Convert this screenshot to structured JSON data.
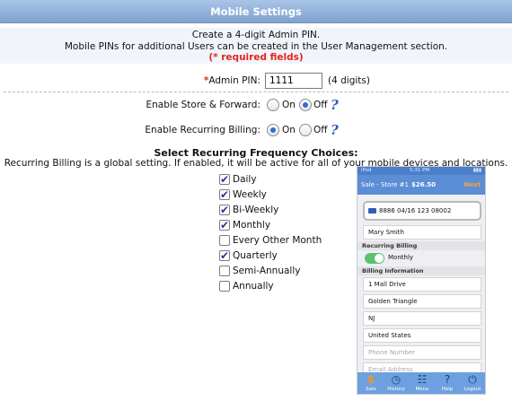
{
  "header": {
    "title": "Mobile Settings"
  },
  "intro": {
    "line1": "Create a 4-digit Admin PIN.",
    "line2": "Mobile PINs for additional Users can be created in the User Management section.",
    "required_note": "(* required fields)"
  },
  "admin_pin": {
    "star": "*",
    "label": "Admin PIN:",
    "value": "1111",
    "hint": "(4 digits)"
  },
  "store_forward": {
    "label": "Enable Store & Forward:",
    "on_label": "On",
    "off_label": "Off",
    "selected": "Off"
  },
  "recurring_billing": {
    "label": "Enable Recurring Billing:",
    "on_label": "On",
    "off_label": "Off",
    "selected": "On"
  },
  "frequency": {
    "title": "Select Recurring Frequency Choices:",
    "note": "Recurring Billing is a global setting. If enabled, it will be active for all of your mobile devices and locations.",
    "options": [
      {
        "label": "Daily",
        "checked": true
      },
      {
        "label": "Weekly",
        "checked": true
      },
      {
        "label": "Bi-Weekly",
        "checked": true
      },
      {
        "label": "Monthly",
        "checked": true
      },
      {
        "label": "Every Other Month",
        "checked": false
      },
      {
        "label": "Quarterly",
        "checked": true
      },
      {
        "label": "Semi-Annually",
        "checked": false
      },
      {
        "label": "Annually",
        "checked": false
      }
    ]
  },
  "phone_preview": {
    "status_left": "iPod",
    "status_time": "5:31 PM",
    "nav_title": "Sale - Store #1",
    "nav_amount": "$26.50",
    "nav_next": "Next",
    "card_line": "8886 04/16   123   08002",
    "name": "Mary Smith",
    "recurring_header": "Recurring Billing",
    "recurring_value": "Monthly",
    "billing_header": "Billing Information",
    "address": "1 Mall Drive",
    "city": "Golden Triangle",
    "state": "NJ",
    "country": "United States",
    "phone_placeholder": "Phone Number",
    "email_placeholder": "Email Address",
    "tabs": [
      "Sale",
      "History",
      "Menu",
      "Help",
      "Logout"
    ]
  },
  "colors": {
    "header_blue": "#7fa2cf",
    "required_red": "#e2261d",
    "help_blue": "#2b5cb8"
  }
}
